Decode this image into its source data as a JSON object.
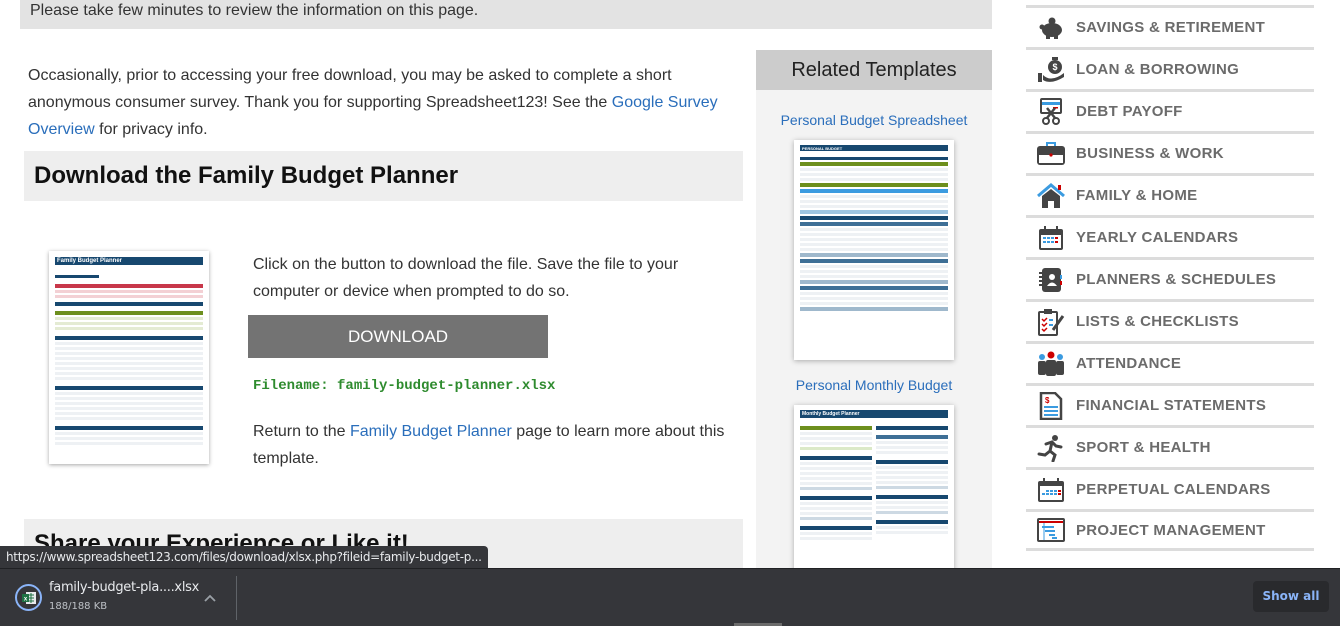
{
  "notice": "Please take few minutes to review the information on this page.",
  "intro": {
    "text_before": "Occasionally, prior to accessing your free download, you may be asked to complete a short anonymous consumer survey. Thank you for supporting Spreadsheet123! See the ",
    "link": "Google Survey Overview",
    "text_after": " for privacy info."
  },
  "download_section": {
    "heading": "Download the Family Budget Planner",
    "thumbnail_title": "Family Budget Planner",
    "instructions": "Click on the button to download the file. Save the file to your computer or device when prompted to do so.",
    "button_label": "DOWNLOAD",
    "filename": "Filename: family-budget-planner.xlsx",
    "return_before": "Return to the ",
    "return_link": "Family Budget Planner",
    "return_after": " page to learn more about this template."
  },
  "share_section": {
    "heading": "Share your Experience or Like it!"
  },
  "related": {
    "heading": "Related Templates",
    "items": [
      {
        "label": "Personal Budget Spreadsheet",
        "thumb_title": "PERSONAL BUDGET"
      },
      {
        "label": "Personal Monthly Budget",
        "thumb_title": "Monthly Budget Planner"
      }
    ]
  },
  "categories": [
    {
      "label": "SAVINGS & RETIREMENT",
      "icon": "piggy-bank-icon"
    },
    {
      "label": "LOAN & BORROWING",
      "icon": "money-bag-hand-icon"
    },
    {
      "label": "DEBT PAYOFF",
      "icon": "card-scissors-icon"
    },
    {
      "label": "BUSINESS & WORK",
      "icon": "briefcase-icon"
    },
    {
      "label": "FAMILY & HOME",
      "icon": "house-icon"
    },
    {
      "label": "YEARLY CALENDARS",
      "icon": "calendar-icon"
    },
    {
      "label": "PLANNERS & SCHEDULES",
      "icon": "planner-book-icon"
    },
    {
      "label": "LISTS & CHECKLISTS",
      "icon": "checklist-icon"
    },
    {
      "label": "ATTENDANCE",
      "icon": "people-icon"
    },
    {
      "label": "FINANCIAL STATEMENTS",
      "icon": "statement-document-icon"
    },
    {
      "label": "SPORT & HEALTH",
      "icon": "runner-icon"
    },
    {
      "label": "PERPETUAL CALENDARS",
      "icon": "perpetual-calendar-icon"
    },
    {
      "label": "PROJECT MANAGEMENT",
      "icon": "gantt-chart-icon"
    }
  ],
  "status_url": "https://www.spreadsheet123.com/files/download/xlsx.php?fileid=family-budget-p...",
  "download_shelf": {
    "file_name": "family-budget-pla....xlsx",
    "file_size": "188/188 KB",
    "show_all_label": "Show all"
  },
  "colors": {
    "link": "#2a6ebb",
    "filename_green": "#2e8b2e",
    "download_button": "#737373",
    "category_text": "#6b6b6b",
    "shelf_bg": "#35363a",
    "show_all_text": "#8ab4f8"
  }
}
